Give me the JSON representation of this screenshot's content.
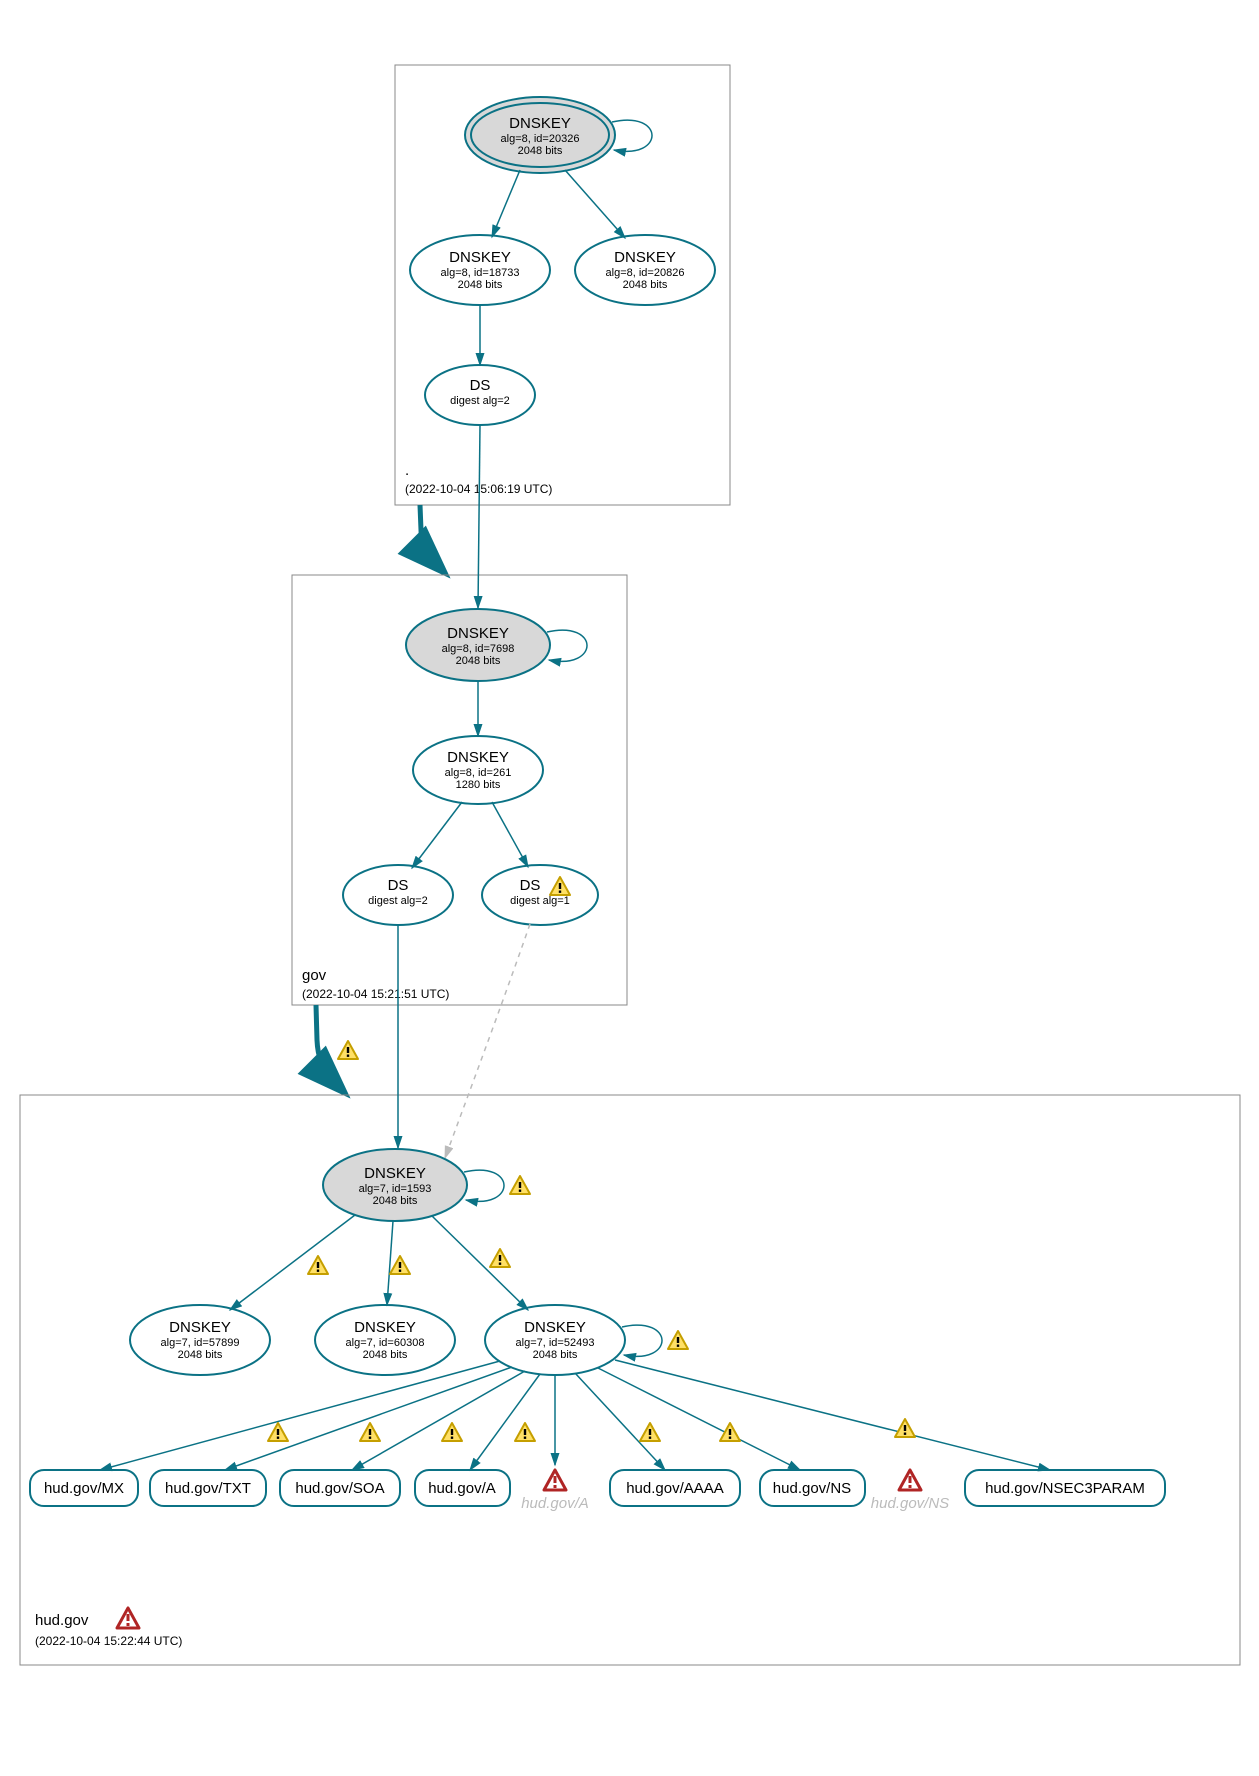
{
  "zones": {
    "root": {
      "name": ".",
      "timestamp": "(2022-10-04 15:06:19 UTC)"
    },
    "gov": {
      "name": "gov",
      "timestamp": "(2022-10-04 15:21:51 UTC)"
    },
    "hud": {
      "name": "hud.gov",
      "timestamp": "(2022-10-04 15:22:44 UTC)"
    }
  },
  "nodes": {
    "root_ksk": {
      "title": "DNSKEY",
      "l1": "alg=8, id=20326",
      "l2": "2048 bits"
    },
    "root_zsk1": {
      "title": "DNSKEY",
      "l1": "alg=8, id=18733",
      "l2": "2048 bits"
    },
    "root_zsk2": {
      "title": "DNSKEY",
      "l1": "alg=8, id=20826",
      "l2": "2048 bits"
    },
    "root_ds": {
      "title": "DS",
      "l1": "digest alg=2",
      "l2": ""
    },
    "gov_ksk": {
      "title": "DNSKEY",
      "l1": "alg=8, id=7698",
      "l2": "2048 bits"
    },
    "gov_zsk": {
      "title": "DNSKEY",
      "l1": "alg=8, id=261",
      "l2": "1280 bits"
    },
    "gov_ds2": {
      "title": "DS",
      "l1": "digest alg=2",
      "l2": ""
    },
    "gov_ds1": {
      "title": "DS",
      "l1": "digest alg=1",
      "l2": ""
    },
    "hud_ksk": {
      "title": "DNSKEY",
      "l1": "alg=7, id=1593",
      "l2": "2048 bits"
    },
    "hud_z1": {
      "title": "DNSKEY",
      "l1": "alg=7, id=57899",
      "l2": "2048 bits"
    },
    "hud_z2": {
      "title": "DNSKEY",
      "l1": "alg=7, id=60308",
      "l2": "2048 bits"
    },
    "hud_z3": {
      "title": "DNSKEY",
      "l1": "alg=7, id=52493",
      "l2": "2048 bits"
    }
  },
  "rrsets": {
    "mx": "hud.gov/MX",
    "txt": "hud.gov/TXT",
    "soa": "hud.gov/SOA",
    "a": "hud.gov/A",
    "a_g": "hud.gov/A",
    "aaaa": "hud.gov/AAAA",
    "ns": "hud.gov/NS",
    "ns_g": "hud.gov/NS",
    "nsec3": "hud.gov/NSEC3PARAM"
  },
  "colors": {
    "teal": "#0b7285",
    "warn_fill": "#ffe066",
    "warn_stroke": "#c59f00",
    "err_stroke": "#b02525"
  },
  "chart_data": {
    "type": "table",
    "description": "DNSSEC authentication chain graph (DNSViz-style) for hud.gov, showing DNSKEY/DS records per zone and RRSIG edges to RRsets. Yellow triangles = warnings, red triangles = errors.",
    "zones": [
      {
        "zone": ".",
        "timestamp": "2022-10-04 15:06:19 UTC",
        "keys": [
          {
            "rr": "DNSKEY",
            "alg": 8,
            "id": 20326,
            "bits": 2048,
            "role": "KSK/SEP",
            "self_signed": true
          },
          {
            "rr": "DNSKEY",
            "alg": 8,
            "id": 18733,
            "bits": 2048,
            "role": "ZSK"
          },
          {
            "rr": "DNSKEY",
            "alg": 8,
            "id": 20826,
            "bits": 2048,
            "role": "ZSK"
          }
        ],
        "ds_for_child": [
          {
            "rr": "DS",
            "digest_alg": 2,
            "child": "gov"
          }
        ]
      },
      {
        "zone": "gov",
        "timestamp": "2022-10-04 15:21:51 UTC",
        "keys": [
          {
            "rr": "DNSKEY",
            "alg": 8,
            "id": 7698,
            "bits": 2048,
            "role": "KSK/SEP",
            "self_signed": true
          },
          {
            "rr": "DNSKEY",
            "alg": 8,
            "id": 261,
            "bits": 1280,
            "role": "ZSK"
          }
        ],
        "ds_for_child": [
          {
            "rr": "DS",
            "digest_alg": 2,
            "child": "hud.gov",
            "status": "secure"
          },
          {
            "rr": "DS",
            "digest_alg": 1,
            "child": "hud.gov",
            "status": "warning"
          }
        ],
        "delegation_status": "warning"
      },
      {
        "zone": "hud.gov",
        "timestamp": "2022-10-04 15:22:44 UTC",
        "zone_status": "error",
        "keys": [
          {
            "rr": "DNSKEY",
            "alg": 7,
            "id": 1593,
            "bits": 2048,
            "role": "KSK/SEP",
            "self_signed": true,
            "self_sig_status": "warning"
          },
          {
            "rr": "DNSKEY",
            "alg": 7,
            "id": 57899,
            "bits": 2048,
            "role": "ZSK",
            "signed_by_ksk_status": "warning"
          },
          {
            "rr": "DNSKEY",
            "alg": 7,
            "id": 60308,
            "bits": 2048,
            "role": "ZSK",
            "signed_by_ksk_status": "warning"
          },
          {
            "rr": "DNSKEY",
            "alg": 7,
            "id": 52493,
            "bits": 2048,
            "role": "ZSK",
            "self_signed": true,
            "self_sig_status": "warning",
            "signed_by_ksk_status": "warning"
          }
        ],
        "rrsets": [
          {
            "name": "hud.gov/MX",
            "signed_by": 52493,
            "status": "warning"
          },
          {
            "name": "hud.gov/TXT",
            "signed_by": 52493,
            "status": "warning"
          },
          {
            "name": "hud.gov/SOA",
            "signed_by": 52493,
            "status": "warning"
          },
          {
            "name": "hud.gov/A",
            "signed_by": 52493,
            "status": "warning"
          },
          {
            "name": "hud.gov/A",
            "signed_by": null,
            "status": "error"
          },
          {
            "name": "hud.gov/AAAA",
            "signed_by": 52493,
            "status": "warning"
          },
          {
            "name": "hud.gov/NS",
            "signed_by": 52493,
            "status": "warning"
          },
          {
            "name": "hud.gov/NS",
            "signed_by": null,
            "status": "error"
          },
          {
            "name": "hud.gov/NSEC3PARAM",
            "signed_by": 52493,
            "status": "warning"
          }
        ]
      }
    ],
    "edges": [
      {
        "from": "./DNSKEY/20326",
        "to": "./DNSKEY/20326",
        "kind": "self-loop"
      },
      {
        "from": "./DNSKEY/20326",
        "to": "./DNSKEY/18733"
      },
      {
        "from": "./DNSKEY/20326",
        "to": "./DNSKEY/20826"
      },
      {
        "from": "./DNSKEY/18733",
        "to": "./DS(digest_alg=2)"
      },
      {
        "from": "./DS(digest_alg=2)",
        "to": "gov/DNSKEY/7698"
      },
      {
        "from": ".",
        "to": "gov",
        "kind": "delegation"
      },
      {
        "from": "gov/DNSKEY/7698",
        "to": "gov/DNSKEY/7698",
        "kind": "self-loop"
      },
      {
        "from": "gov/DNSKEY/7698",
        "to": "gov/DNSKEY/261"
      },
      {
        "from": "gov/DNSKEY/261",
        "to": "gov/DS(digest_alg=2)"
      },
      {
        "from": "gov/DNSKEY/261",
        "to": "gov/DS(digest_alg=1)",
        "status": "warning"
      },
      {
        "from": "gov/DS(digest_alg=2)",
        "to": "hud.gov/DNSKEY/1593"
      },
      {
        "from": "gov/DS(digest_alg=1)",
        "to": "hud.gov/DNSKEY/1593",
        "kind": "dashed"
      },
      {
        "from": "gov",
        "to": "hud.gov",
        "kind": "delegation",
        "status": "warning"
      },
      {
        "from": "hud.gov/DNSKEY/1593",
        "to": "hud.gov/DNSKEY/1593",
        "kind": "self-loop",
        "status": "warning"
      },
      {
        "from": "hud.gov/DNSKEY/1593",
        "to": "hud.gov/DNSKEY/57899",
        "status": "warning"
      },
      {
        "from": "hud.gov/DNSKEY/1593",
        "to": "hud.gov/DNSKEY/60308",
        "status": "warning"
      },
      {
        "from": "hud.gov/DNSKEY/1593",
        "to": "hud.gov/DNSKEY/52493",
        "status": "warning"
      },
      {
        "from": "hud.gov/DNSKEY/52493",
        "to": "hud.gov/DNSKEY/52493",
        "kind": "self-loop",
        "status": "warning"
      },
      {
        "from": "hud.gov/DNSKEY/52493",
        "to": "hud.gov/MX",
        "status": "warning"
      },
      {
        "from": "hud.gov/DNSKEY/52493",
        "to": "hud.gov/TXT",
        "status": "warning"
      },
      {
        "from": "hud.gov/DNSKEY/52493",
        "to": "hud.gov/SOA",
        "status": "warning"
      },
      {
        "from": "hud.gov/DNSKEY/52493",
        "to": "hud.gov/A",
        "status": "warning"
      },
      {
        "from": "hud.gov/DNSKEY/52493",
        "to": "hud.gov/AAAA",
        "status": "warning"
      },
      {
        "from": "hud.gov/DNSKEY/52493",
        "to": "hud.gov/NS",
        "status": "warning"
      },
      {
        "from": "hud.gov/DNSKEY/52493",
        "to": "hud.gov/NSEC3PARAM",
        "status": "warning"
      }
    ]
  }
}
